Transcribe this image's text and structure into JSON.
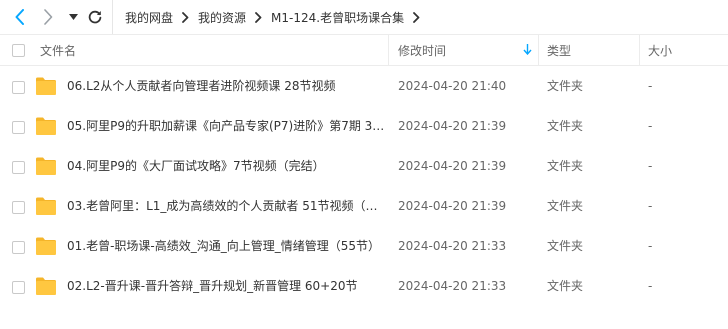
{
  "toolbar": {
    "back_icon": "chevron-left-icon",
    "forward_icon": "chevron-right-icon",
    "dropdown_icon": "caret-down-icon",
    "refresh_icon": "refresh-icon"
  },
  "breadcrumb": [
    "我的网盘",
    "我的资源",
    "M1-124.老曾职场课合集"
  ],
  "header": {
    "name": "文件名",
    "modified": "修改时间",
    "type": "类型",
    "size": "大小"
  },
  "files": [
    {
      "name": "06.L2从个人贡献者向管理者进阶视频课 28节视频",
      "modified": "2024-04-20 21:40",
      "type": "文件夹",
      "size": "-"
    },
    {
      "name": "05.阿里P9的升职加薪课《向产品专家(P7)进阶》第7期 3…",
      "modified": "2024-04-20 21:39",
      "type": "文件夹",
      "size": "-"
    },
    {
      "name": "04.阿里P9的《大厂面试攻略》7节视频（完结）",
      "modified": "2024-04-20 21:39",
      "type": "文件夹",
      "size": "-"
    },
    {
      "name": "03.老曾阿里：L1_成为高绩效的个人贡献者 51节视频（…",
      "modified": "2024-04-20 21:39",
      "type": "文件夹",
      "size": "-"
    },
    {
      "name": "01.老曾-职场课-高绩效_沟通_向上管理_情绪管理（55节）",
      "modified": "2024-04-20 21:33",
      "type": "文件夹",
      "size": "-"
    },
    {
      "name": "02.L2-晋升课-晋升答辩_晋升规划_新晋管理 60+20节",
      "modified": "2024-04-20 21:33",
      "type": "文件夹",
      "size": "-"
    }
  ],
  "colors": {
    "accent": "#06a7ff",
    "folder": "#ffc740",
    "folder_tab": "#f5b52a",
    "divider": "#ececec"
  }
}
